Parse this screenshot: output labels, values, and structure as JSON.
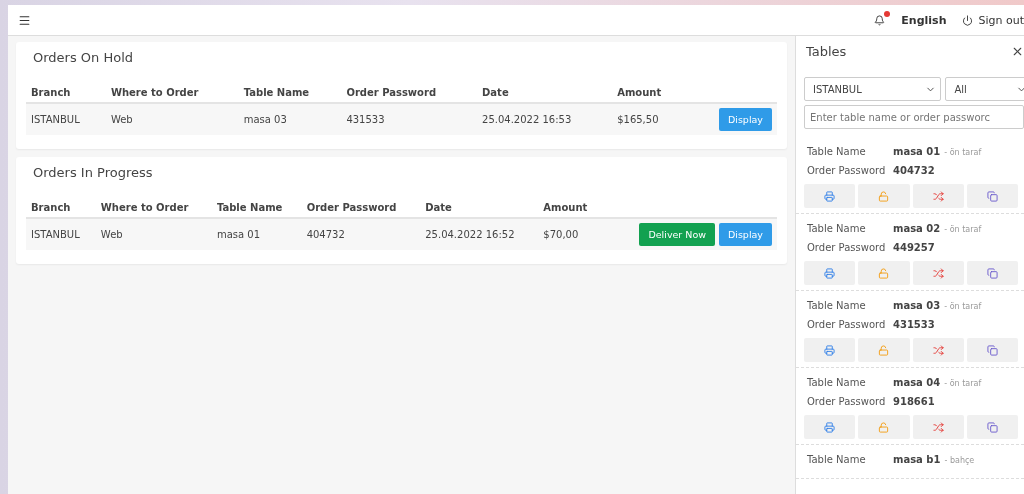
{
  "header": {
    "language": "English",
    "sign_out": "Sign out",
    "has_notification": true
  },
  "panels": [
    {
      "title": "Orders On Hold",
      "columns": [
        "Branch",
        "Where to Order",
        "Table Name",
        "Order Password",
        "Date",
        "Amount"
      ],
      "rows": [
        {
          "cells": [
            "ISTANBUL",
            "Web",
            "masa 03",
            "431533",
            "25.04.2022 16:53",
            "$165,50"
          ],
          "actions": [
            {
              "label": "Display",
              "kind": "info"
            }
          ]
        }
      ]
    },
    {
      "title": "Orders In Progress",
      "columns": [
        "Branch",
        "Where to Order",
        "Table Name",
        "Order Password",
        "Date",
        "Amount"
      ],
      "rows": [
        {
          "cells": [
            "ISTANBUL",
            "Web",
            "masa 01",
            "404732",
            "25.04.2022 16:52",
            "$70,00"
          ],
          "actions": [
            {
              "label": "Deliver Now",
              "kind": "success"
            },
            {
              "label": "Display",
              "kind": "info"
            }
          ]
        }
      ]
    }
  ],
  "sidebar": {
    "title": "Tables",
    "branch_select": "ISTANBUL",
    "status_select": "All",
    "search": {
      "placeholder": "Enter table name or order passworc"
    },
    "tables": [
      {
        "name_label": "Table Name",
        "name": "masa 01",
        "area": "- ön taraf",
        "password_label": "Order Password",
        "password": "404732"
      },
      {
        "name_label": "Table Name",
        "name": "masa 02",
        "area": "- ön taraf",
        "password_label": "Order Password",
        "password": "449257"
      },
      {
        "name_label": "Table Name",
        "name": "masa 03",
        "area": "- ön taraf",
        "password_label": "Order Password",
        "password": "431533"
      },
      {
        "name_label": "Table Name",
        "name": "masa 04",
        "area": "- ön taraf",
        "password_label": "Order Password",
        "password": "918661"
      },
      {
        "name_label": "Table Name",
        "name": "masa b1",
        "area": "- bahçe"
      }
    ]
  }
}
